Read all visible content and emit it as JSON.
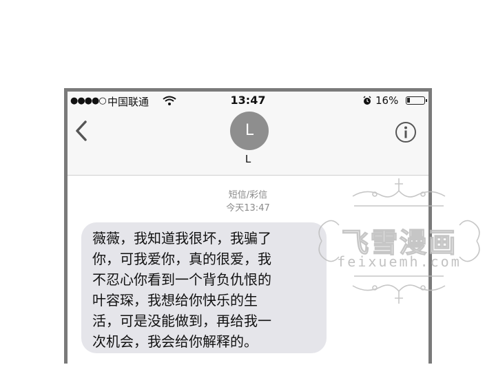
{
  "status_bar": {
    "signal": "●●●●○",
    "carrier": "中国联通",
    "time": "13:47",
    "battery_percent": "16%",
    "battery_level": 0.16
  },
  "nav": {
    "avatar_initial": "L",
    "contact_name": "L"
  },
  "thread": {
    "message_type": "短信/彩信",
    "timestamp": "今天13:47",
    "message_lines": [
      "薇薇，我知道我很坏，我骗了",
      "你，可我爱你，真的很爱，我",
      "不忍心你看到一个背负仇恨的",
      "叶容琛，我想给你快乐的生",
      "活，可是没能做到，再给我一",
      "次机会，我会给你解释的。"
    ]
  },
  "watermark": {
    "title": "飞雪漫画",
    "url": "feixuemh.com"
  },
  "colors": {
    "bubble": "#e5e5ea",
    "frame": "#7a7a7a",
    "avatar": "#8e8e8e",
    "bar": "#f7f7f7"
  },
  "icons": [
    "back-chevron-icon",
    "info-icon",
    "wifi-icon",
    "alarm-clock-icon",
    "battery-icon"
  ]
}
